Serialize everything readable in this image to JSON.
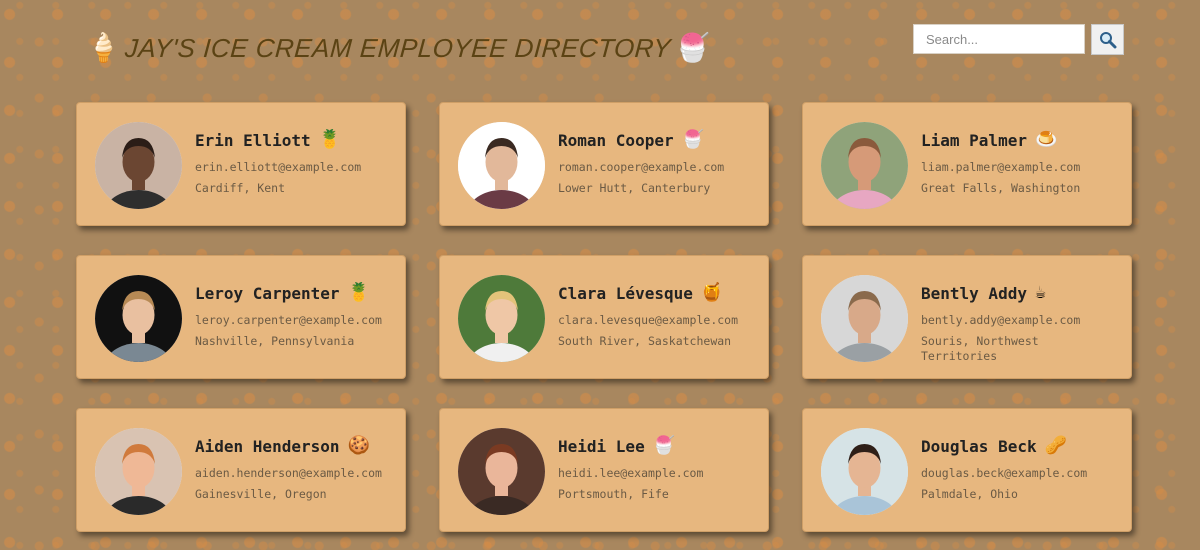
{
  "header": {
    "title": "JAY'S ICE CREAM EMPLOYEE DIRECTORY",
    "left_icon": "soft-serve-cone-icon",
    "left_icon_glyph": "🍦",
    "right_icon": "shaved-ice-icon",
    "right_icon_glyph": "🍧"
  },
  "search": {
    "placeholder": "Search...",
    "value": "",
    "button_icon": "magnifying-glass-icon"
  },
  "employees": [
    {
      "name": "Erin Elliott",
      "email": "erin.elliott@example.com",
      "location": "Cardiff, Kent",
      "treat_icon": "pineapple-icon",
      "treat_glyph": "🍍",
      "avatar": {
        "bg": "#c9b3a4",
        "skin": "#6b4632",
        "hair": "#2b1d17",
        "shirt": "#2e2e2e"
      }
    },
    {
      "name": "Roman Cooper",
      "email": "roman.cooper@example.com",
      "location": "Lower Hutt, Canterbury",
      "treat_icon": "shaved-ice-icon",
      "treat_glyph": "🍧",
      "avatar": {
        "bg": "#ffffff",
        "skin": "#e2b89a",
        "hair": "#3a2a22",
        "shirt": "#6a3b45"
      }
    },
    {
      "name": "Liam Palmer",
      "email": "liam.palmer@example.com",
      "location": "Great Falls, Washington",
      "treat_icon": "custard-icon",
      "treat_glyph": "🍮",
      "avatar": {
        "bg": "#8fa37a",
        "skin": "#d69a78",
        "hair": "#8a5a3c",
        "shirt": "#e7a7c2"
      }
    },
    {
      "name": "Leroy Carpenter",
      "email": "leroy.carpenter@example.com",
      "location": "Nashville, Pennsylvania",
      "treat_icon": "pineapple-icon",
      "treat_glyph": "🍍",
      "avatar": {
        "bg": "#111111",
        "skin": "#e9c0a0",
        "hair": "#b78a55",
        "shirt": "#7a8893"
      }
    },
    {
      "name": "Clara Lévesque",
      "email": "clara.levesque@example.com",
      "location": "South River, Saskatchewan",
      "treat_icon": "honey-pot-icon",
      "treat_glyph": "🍯",
      "avatar": {
        "bg": "#4e7a3a",
        "skin": "#efc7a6",
        "hair": "#e3c37a",
        "shirt": "#f0f0f0"
      }
    },
    {
      "name": "Bently Addy",
      "email": "bently.addy@example.com",
      "location": "Souris, Northwest Territories",
      "treat_icon": "hot-beverage-icon",
      "treat_glyph": "☕",
      "avatar": {
        "bg": "#d7d7d7",
        "skin": "#d8a989",
        "hair": "#8a6a4c",
        "shirt": "#9aa0a4"
      }
    },
    {
      "name": "Aiden Henderson",
      "email": "aiden.henderson@example.com",
      "location": "Gainesville, Oregon",
      "treat_icon": "cookie-icon",
      "treat_glyph": "🍪",
      "avatar": {
        "bg": "#d9c3b2",
        "skin": "#efb896",
        "hair": "#d07a3c",
        "shirt": "#2a2a2a"
      }
    },
    {
      "name": "Heidi Lee",
      "email": "heidi.lee@example.com",
      "location": "Portsmouth, Fife",
      "treat_icon": "shaved-ice-icon",
      "treat_glyph": "🍧",
      "avatar": {
        "bg": "#5a3a2e",
        "skin": "#eab69a",
        "hair": "#7a3a22",
        "shirt": "#3a2a24"
      }
    },
    {
      "name": "Douglas Beck",
      "email": "douglas.beck@example.com",
      "location": "Palmdale, Ohio",
      "treat_icon": "peanuts-icon",
      "treat_glyph": "🥜",
      "avatar": {
        "bg": "#d6e3e6",
        "skin": "#e5b593",
        "hair": "#2e1f18",
        "shirt": "#a9c4d8"
      }
    }
  ]
}
